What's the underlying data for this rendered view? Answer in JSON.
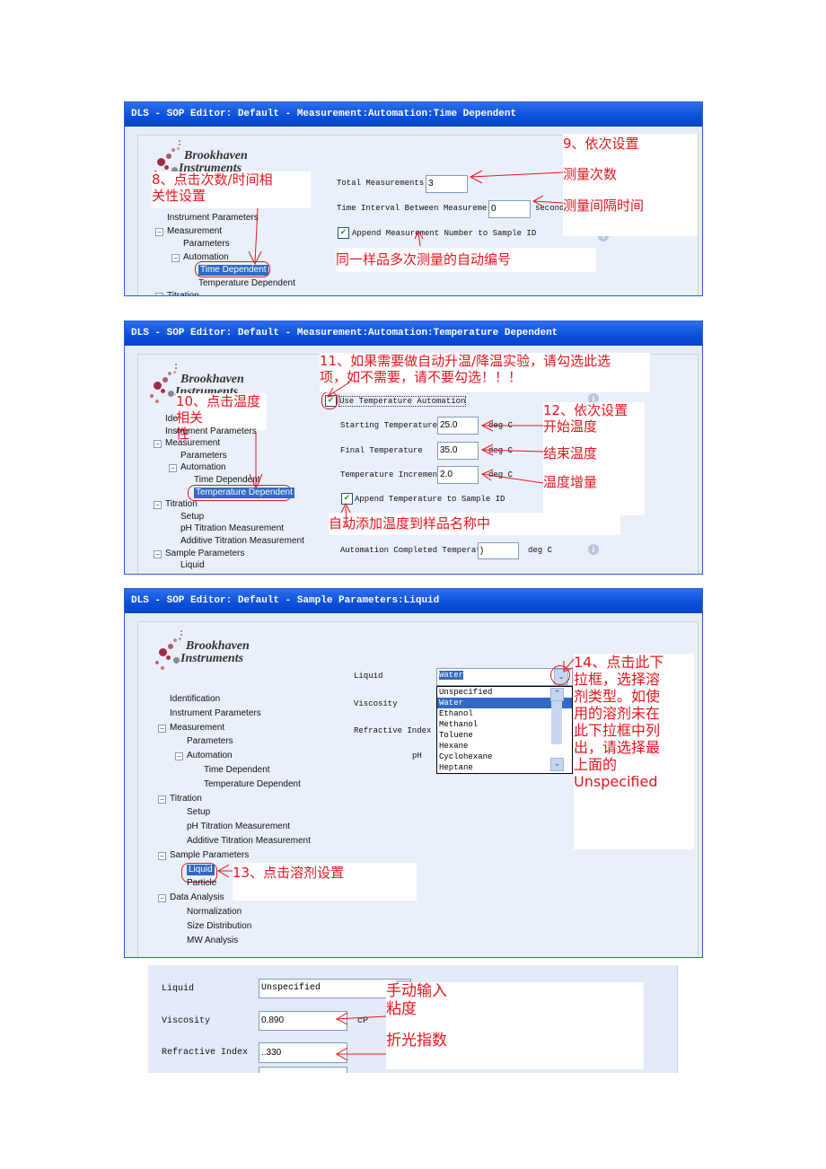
{
  "logo": {
    "line1": "Brookhaven",
    "line2": "Instruments"
  },
  "panel1": {
    "title": "DLS - SOP Editor: Default - Measurement:Automation:Time Dependent",
    "tree": [
      {
        "label": "Instrument Parameters",
        "level": 1
      },
      {
        "label": "Measurement",
        "level": 1,
        "expander": "−"
      },
      {
        "label": "Parameters",
        "level": 2
      },
      {
        "label": "Automation",
        "level": 2,
        "expander": "−"
      },
      {
        "label": "Time Dependent",
        "level": 3,
        "selected": true
      },
      {
        "label": "Temperature Dependent",
        "level": 3
      },
      {
        "label": "Titration",
        "level": 1,
        "expander": "−"
      }
    ],
    "total_label": "Total Measurements",
    "total_value": "3",
    "interval_label": "Time Interval Between Measureme",
    "interval_value": "0",
    "interval_unit": "second",
    "append_label": "Append Measurement Number to Sample ID",
    "append_checked": true,
    "note8": [
      "8、点击次数/时间相",
      "关性设置"
    ],
    "note9": [
      "9、依次设置",
      "测量次数",
      "测量间隔时间"
    ],
    "note_auto": "同一样品多次测量的自动编号"
  },
  "panel2": {
    "title": "DLS - SOP Editor: Default - Measurement:Automation:Temperature Dependent",
    "tree": [
      {
        "label": "Ide",
        "level": 1
      },
      {
        "label": "Instrument Parameters",
        "level": 1
      },
      {
        "label": "Measurement",
        "level": 1,
        "expander": "−"
      },
      {
        "label": "Parameters",
        "level": 2
      },
      {
        "label": "Automation",
        "level": 2,
        "expander": "−"
      },
      {
        "label": "Time Dependent",
        "level": 3
      },
      {
        "label": "Temperature Dependent",
        "level": 3,
        "selected": true
      },
      {
        "label": "Titration",
        "level": 1,
        "expander": "−"
      },
      {
        "label": "Setup",
        "level": 2
      },
      {
        "label": "pH Titration Measurement",
        "level": 2
      },
      {
        "label": "Additive Titration Measurement",
        "level": 2
      },
      {
        "label": "Sample Parameters",
        "level": 1,
        "expander": "−"
      },
      {
        "label": "Liquid",
        "level": 2
      }
    ],
    "use_auto_label": "Use Temperature Automation",
    "use_auto_checked": true,
    "start_label": "Starting Temperature",
    "start_value": "25.0",
    "final_label": "Final Temperature",
    "final_value": "35.0",
    "incr_label": "Temperature Increment",
    "incr_value": "2.0",
    "unit": "deg C",
    "append_label": "Append Temperature to Sample ID",
    "append_checked": true,
    "completed_label": "Automation Completed  Temperature",
    "completed_value": ")",
    "note11": [
      "11、如果需要做自动升温/降温实验，请勾选此选",
      "项，如不需要，请不要勾选！！！"
    ],
    "note10": [
      "10、点击温度相关",
      "性"
    ],
    "note12": [
      "12、依次设置",
      "开始温度"
    ],
    "note_end": "结束温度",
    "note_incr": "温度增量",
    "note_append": "自动添加温度到样品名称中"
  },
  "panel3": {
    "title": "DLS - SOP Editor: Default - Sample Parameters:Liquid",
    "tree": [
      {
        "label": "Identification",
        "level": 1
      },
      {
        "label": "Instrument Parameters",
        "level": 1
      },
      {
        "label": "Measurement",
        "level": 1,
        "expander": "−"
      },
      {
        "label": "Parameters",
        "level": 2
      },
      {
        "label": "Automation",
        "level": 2,
        "expander": "−"
      },
      {
        "label": "Time Dependent",
        "level": 3
      },
      {
        "label": "Temperature Dependent",
        "level": 3
      },
      {
        "label": "Titration",
        "level": 1,
        "expander": "−"
      },
      {
        "label": "Setup",
        "level": 2
      },
      {
        "label": "pH Titration Measurement",
        "level": 2
      },
      {
        "label": "Additive Titration Measurement",
        "level": 2
      },
      {
        "label": "Sample Parameters",
        "level": 1,
        "expander": "−"
      },
      {
        "label": "Liquid",
        "level": 2,
        "selected": true
      },
      {
        "label": "Particle",
        "level": 2
      },
      {
        "label": "Data Analysis",
        "level": 1,
        "expander": "−"
      },
      {
        "label": "Normalization",
        "level": 2
      },
      {
        "label": "Size Distribution",
        "level": 2
      },
      {
        "label": "MW Analysis",
        "level": 2
      }
    ],
    "liquid_label": "Liquid",
    "liquid_value": "Water",
    "viscosity_label": "Viscosity",
    "ri_label": "Refractive Index",
    "ph_label": "pH",
    "options": [
      "Unspecified",
      "Water",
      "Ethanol",
      "Methanol",
      "Toluene",
      "Hexane",
      "Cyclohexane",
      "Heptane"
    ],
    "highlighted_option": "Water",
    "note13": "13、点击溶剂设置",
    "note14": [
      "14、点击此下",
      "拉框，选择溶",
      "剂类型。如使",
      "用的溶剂未在",
      "此下拉框中列",
      "出，请选择最",
      "上面的",
      "Unspecified"
    ]
  },
  "panel4": {
    "liquid_label": "Liquid",
    "liquid_value": "Unspecified",
    "viscosity_label": "Viscosity",
    "viscosity_value": "0.890",
    "viscosity_unit": "cP",
    "ri_label": "Refractive Index",
    "ri_value": "..330",
    "note_manual": [
      "手动输入",
      "粘度"
    ],
    "note_ri": "折光指数"
  },
  "colors": {
    "annotation": "#e8141e",
    "titlebar": "#0a4fd8",
    "selection": "#316ac5"
  }
}
